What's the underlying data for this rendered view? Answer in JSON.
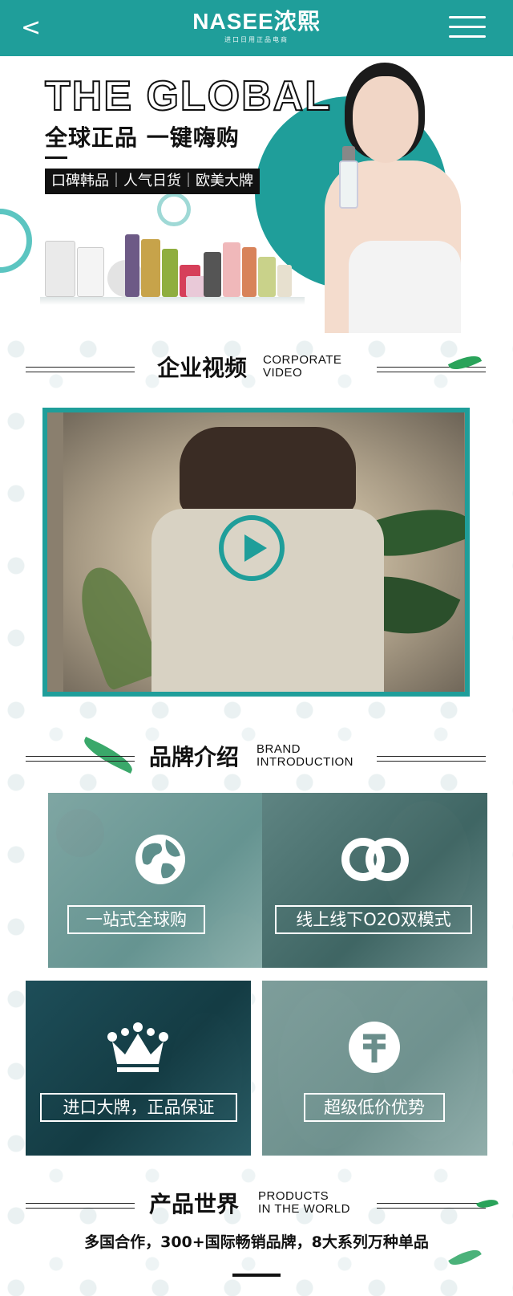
{
  "header": {
    "back_label": "<",
    "logo_main": "NASEE浓熙",
    "logo_sub": "进口日用正品电商",
    "menu_icon": "hamburger-menu-icon"
  },
  "hero": {
    "title": "THE GLOBAL",
    "subtitle": "全球正品 一键嗨购",
    "tags": "口碑韩品｜人气日货｜欧美大牌"
  },
  "sections": {
    "video": {
      "cn": "企业视频",
      "en_line1": "CORPORATE",
      "en_line2": "VIDEO"
    },
    "brand": {
      "cn": "品牌介绍",
      "en_line1": "BRAND",
      "en_line2": "INTRODUCTION"
    },
    "products": {
      "cn": "产品世界",
      "en_line1": "PRODUCTS",
      "en_line2": "IN THE WORLD"
    }
  },
  "video": {
    "play_icon": "play-icon"
  },
  "brand_cards": [
    {
      "label": "一站式全球购",
      "icon": "globe-icon"
    },
    {
      "label": "线上线下O2O双模式",
      "icon": "double-ring-icon"
    },
    {
      "label": "进口大牌，正品保证",
      "icon": "crown-icon"
    },
    {
      "label": "超级低价优势",
      "icon": "yen-icon"
    }
  ],
  "products_slogan": "多国合作，300+国际畅销品牌，8大系列万种单品",
  "colors": {
    "brand_teal": "#1f9e9a",
    "text_dark": "#111111"
  }
}
